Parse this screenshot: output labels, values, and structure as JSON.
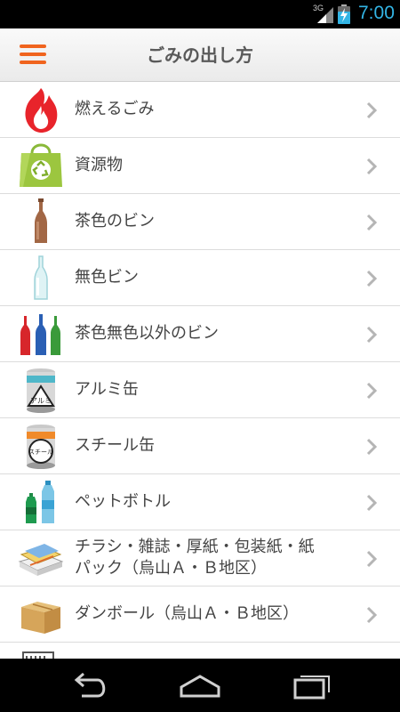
{
  "status_bar": {
    "network": "3G",
    "time": "7:00"
  },
  "app_bar": {
    "title": "ごみの出し方",
    "menu_icon": "hamburger-menu-icon",
    "accent_color": "#f0641e"
  },
  "categories": [
    {
      "label": "燃えるごみ",
      "icon": "flame-icon"
    },
    {
      "label": "資源物",
      "icon": "recycle-bag-icon"
    },
    {
      "label": "茶色のビン",
      "icon": "brown-bottle-icon"
    },
    {
      "label": "無色ビン",
      "icon": "clear-bottle-icon"
    },
    {
      "label": "茶色無色以外のビン",
      "icon": "colored-bottles-icon"
    },
    {
      "label": "アルミ缶",
      "icon": "aluminum-can-icon",
      "icon_text": "アルミ"
    },
    {
      "label": "スチール缶",
      "icon": "steel-can-icon",
      "icon_text": "スチール"
    },
    {
      "label": "ペットボトル",
      "icon": "pet-bottle-icon"
    },
    {
      "label": "チラシ・雑誌・厚紙・包装紙・紙",
      "label_line2": "パック（烏山Ａ・Ｂ地区）",
      "icon": "paper-bundle-icon"
    },
    {
      "label": "ダンボール（烏山Ａ・Ｂ地区）",
      "icon": "cardboard-box-icon"
    },
    {
      "label": "",
      "icon": "partial-item-icon"
    }
  ],
  "nav_bar": {
    "back": "back-icon",
    "home": "home-icon",
    "recents": "recent-apps-icon"
  }
}
